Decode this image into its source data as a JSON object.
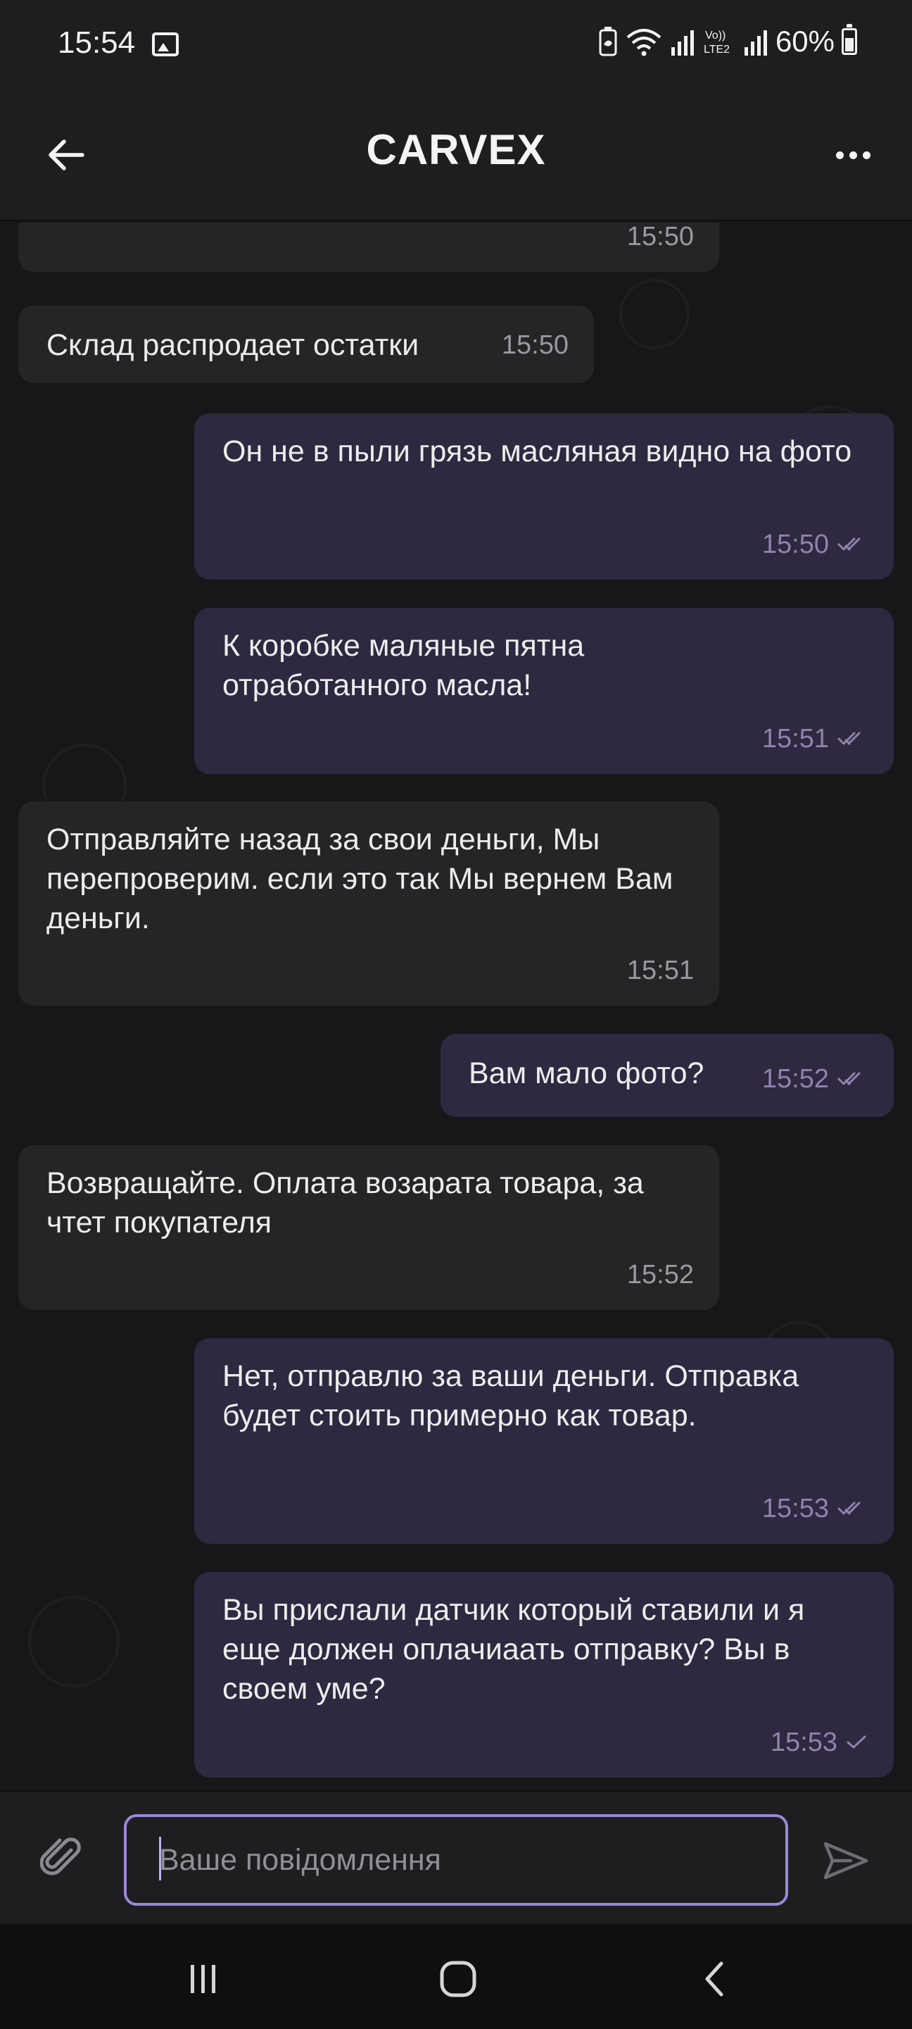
{
  "status_bar": {
    "time": "15:54",
    "gallery_icon": "image-icon",
    "battery_saver_icon": "battery-saver-icon",
    "wifi_icon": "wifi-icon",
    "signal_icon": "signal-icon",
    "volte_label": "Vo)) LTE2",
    "battery_percent": "60%"
  },
  "header": {
    "title": "CARVEX",
    "back_icon": "arrow-left-icon",
    "menu_icon": "more-horizontal-icon"
  },
  "messages": [
    {
      "direction": "in",
      "text": "",
      "time": "15:50"
    },
    {
      "direction": "in",
      "text": "Склад распродает остатки",
      "time": "15:50"
    },
    {
      "direction": "out",
      "text": "Он не в пыли грязь масляная видно на фото",
      "time": "15:50",
      "status": "read"
    },
    {
      "direction": "out",
      "text": "К коробке маляные пятна отработанного масла!",
      "time": "15:51",
      "status": "read"
    },
    {
      "direction": "in",
      "text": "Отправляйте назад за свои деньги, Мы перепроверим. если это так Мы вернем Вам деньги.",
      "time": "15:51"
    },
    {
      "direction": "out",
      "text": "Вам мало фото?",
      "time": "15:52",
      "status": "read"
    },
    {
      "direction": "in",
      "text": "Возвращайте. Оплата возарата товара, за чтет покупателя",
      "time": "15:52"
    },
    {
      "direction": "out",
      "text": "Нет,  отправлю за ваши деньги. Отправка будет стоить примерно как товар.",
      "time": "15:53",
      "status": "read"
    },
    {
      "direction": "out",
      "text": "Вы прислали датчик который ставили и я еще должен оплачиаать отправку? Вы в своем уме?",
      "time": "15:53",
      "status": "sent"
    }
  ],
  "composer": {
    "placeholder": "Ваше повідомлення",
    "value": "",
    "attach_icon": "paperclip-icon",
    "send_icon": "send-icon"
  },
  "nav_bar": {
    "recents_icon": "recents-icon",
    "home_icon": "home-icon",
    "back_icon": "nav-back-icon"
  },
  "colors": {
    "background": "#171719",
    "incoming_bubble": "#252527",
    "outgoing_bubble": "#2e2840",
    "accent": "#9b87d6"
  }
}
